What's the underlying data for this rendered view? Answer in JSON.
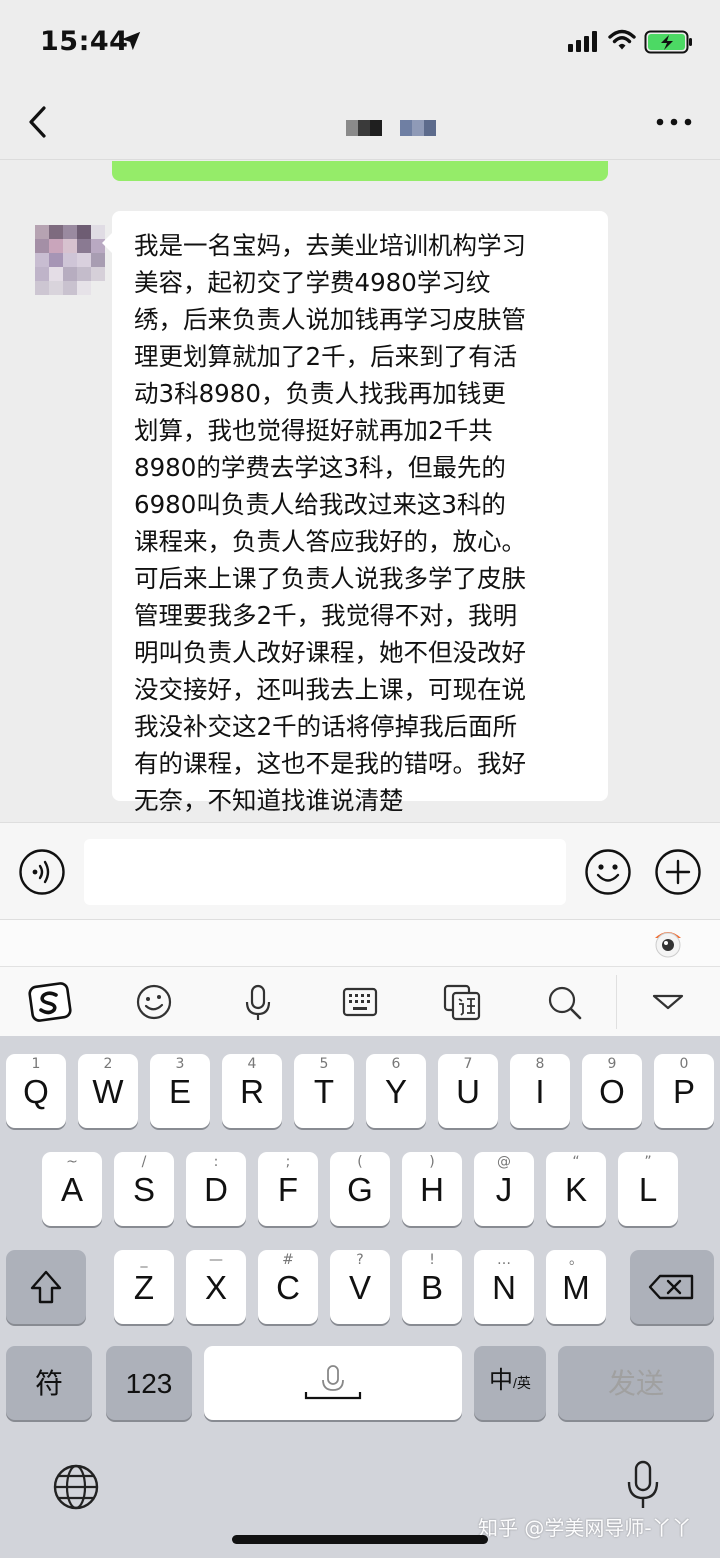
{
  "status_bar": {
    "time": "15:44"
  },
  "nav": {
    "title_obscured": true
  },
  "message": {
    "lines": [
      "我是一名宝妈，去美业培训机构学习",
      "美容，起初交了学费4980学习纹",
      "绣，后来负责人说加钱再学习皮肤管",
      "理更划算就加了2千，后来到了有活",
      "动3科8980，负责人找我再加钱更",
      "划算，我也觉得挺好就再加2千共",
      "8980的学费去学这3科，但最先的",
      "6980叫负责人给我改过来这3科的",
      "课程来，负责人答应我好的，放心。",
      "可后来上课了负责人说我多学了皮肤",
      "管理要我多2千，我觉得不对，我明",
      "明叫负责人改好课程，她不但没改好",
      "没交接好，还叫我去上课，可现在说",
      "我没补交这2千的话将停掉我后面所",
      "有的课程，这也不是我的错呀。我好",
      "无奈，不知道找谁说清楚"
    ]
  },
  "input": {
    "value": ""
  },
  "keyboard": {
    "row1": [
      {
        "k": "Q",
        "h": "1"
      },
      {
        "k": "W",
        "h": "2"
      },
      {
        "k": "E",
        "h": "3"
      },
      {
        "k": "R",
        "h": "4"
      },
      {
        "k": "T",
        "h": "5"
      },
      {
        "k": "Y",
        "h": "6"
      },
      {
        "k": "U",
        "h": "7"
      },
      {
        "k": "I",
        "h": "8"
      },
      {
        "k": "O",
        "h": "9"
      },
      {
        "k": "P",
        "h": "0"
      }
    ],
    "row2": [
      {
        "k": "A",
        "h": "~"
      },
      {
        "k": "S",
        "h": "/"
      },
      {
        "k": "D",
        "h": ":"
      },
      {
        "k": "F",
        "h": ";"
      },
      {
        "k": "G",
        "h": "("
      },
      {
        "k": "H",
        "h": ")"
      },
      {
        "k": "J",
        "h": "@"
      },
      {
        "k": "K",
        "h": "“"
      },
      {
        "k": "L",
        "h": "”"
      }
    ],
    "row3": [
      {
        "k": "Z",
        "h": "_"
      },
      {
        "k": "X",
        "h": "—"
      },
      {
        "k": "C",
        "h": "#"
      },
      {
        "k": "V",
        "h": "?"
      },
      {
        "k": "B",
        "h": "!"
      },
      {
        "k": "N",
        "h": "…"
      },
      {
        "k": "M",
        "h": "。"
      }
    ],
    "symbols_label": "符",
    "numbers_label": "123",
    "lang_main": "中",
    "lang_sub": "/英",
    "send_label": "发送"
  },
  "watermark": "知乎 @学美网导师-丫丫",
  "colors": {
    "bubble_self": "#95ec69",
    "bubble_other": "#ffffff",
    "keyboard_bg": "#d2d4da",
    "battery": "#4cd964"
  }
}
